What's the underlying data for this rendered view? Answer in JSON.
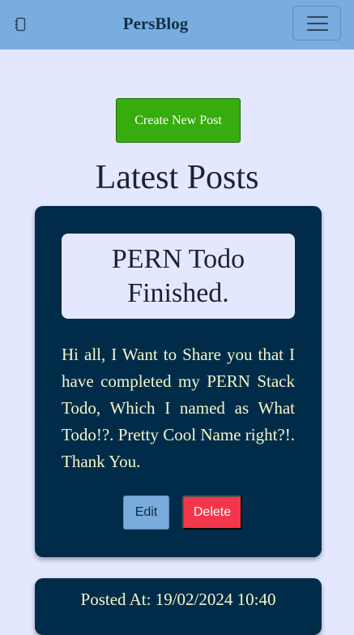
{
  "navbar": {
    "brand": "PersBlog",
    "brand_icon": "notebook-icon",
    "toggler_icon": "hamburger-menu-icon",
    "background": "#7aaddf"
  },
  "main": {
    "create_button_label": "Create New Post",
    "heading": "Latest Posts"
  },
  "posts": [
    {
      "title": "PERN Todo Finished.",
      "body": "Hi all, I Want to Share you that I have completed my PERN Stack Todo, Which I named as What Todo!?. Pretty Cool Name right?!. Thank You.",
      "edit_label": "Edit",
      "delete_label": "Delete",
      "posted_at": "Posted At: 19/02/2024 10:40"
    }
  ],
  "colors": {
    "page_background": "#e4e8ff",
    "card_background": "#002c4a",
    "create_button": "#37ac0f",
    "edit_button": "#79abdc",
    "delete_button": "#f4364c",
    "body_text": "#f4f6c8"
  }
}
